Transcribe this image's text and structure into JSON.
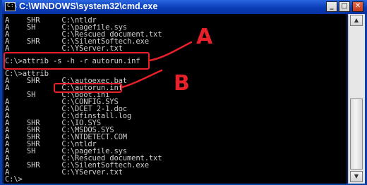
{
  "window": {
    "title": "C:\\WINDOWS\\system32\\cmd.exe",
    "icon_text": "C:\\"
  },
  "titlebar_buttons": {
    "minimize": "_",
    "maximize": "□",
    "close": "✕"
  },
  "console_lines": [
    "A    SHR     C:\\ntldr",
    "A    SH      C:\\pagefile.sys",
    "A            C:\\Rescued document.txt",
    "A    SHR     C:\\SilentSoftech.exe",
    "A            C:\\YServer.txt",
    "",
    "C:\\>attrib -s -h -r autorun.inf",
    "",
    "C:\\>attrib",
    "A    SHR     C:\\autoexec.bat",
    "A            C:\\autorun.inf",
    "     SH      C:\\boot.ini",
    "A            C:\\CONFIG.SYS",
    "A            C:\\DCET 2-1.doc",
    "A            C:\\dfinstall.log",
    "A    SHR     C:\\IO.SYS",
    "A    SHR     C:\\MSDOS.SYS",
    "A    SHR     C:\\NTDETECT.COM",
    "A    SHR     C:\\ntldr",
    "A    SH      C:\\pagefile.sys",
    "A            C:\\Rescued document.txt",
    "A    SHR     C:\\SilentSoftech.exe",
    "A            C:\\YServer.txt",
    "",
    "C:\\>"
  ],
  "annotations": {
    "a_label": "A",
    "b_label": "B"
  },
  "scrollbar": {
    "up": "▲",
    "down": "▼"
  },
  "colors": {
    "console_bg": "#000000",
    "console_text": "#cfcfcf",
    "annotation": "#e8202a",
    "titlebar": "#0a3cb8"
  }
}
